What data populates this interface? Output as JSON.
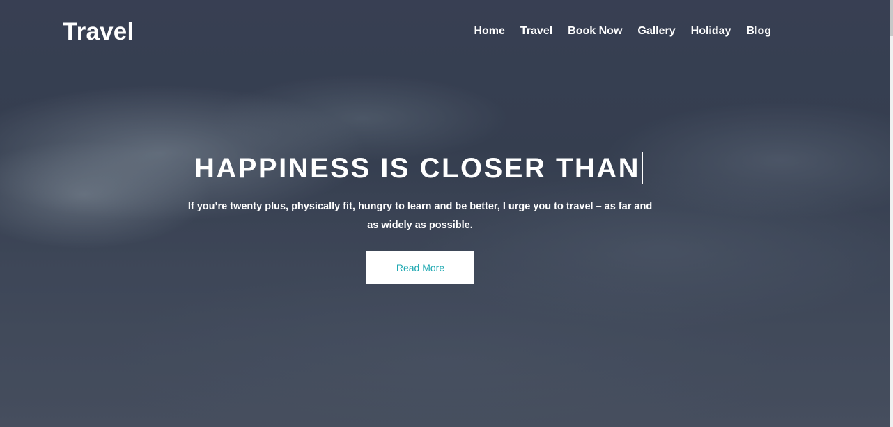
{
  "brand": {
    "logo": "Travel"
  },
  "nav": {
    "items": [
      "Home",
      "Travel",
      "Book Now",
      "Gallery",
      "Holiday",
      "Blog"
    ]
  },
  "hero": {
    "heading": "HAPPINESS IS CLOSER THAN",
    "subtitle": "If you’re twenty plus, physically fit, hungry to learn and be better, I urge you to travel – as far and as widely as possible.",
    "cta_label": "Read More"
  },
  "colors": {
    "accent": "#1aa7b0",
    "text": "#ffffff",
    "overlay": "#3c4656"
  }
}
